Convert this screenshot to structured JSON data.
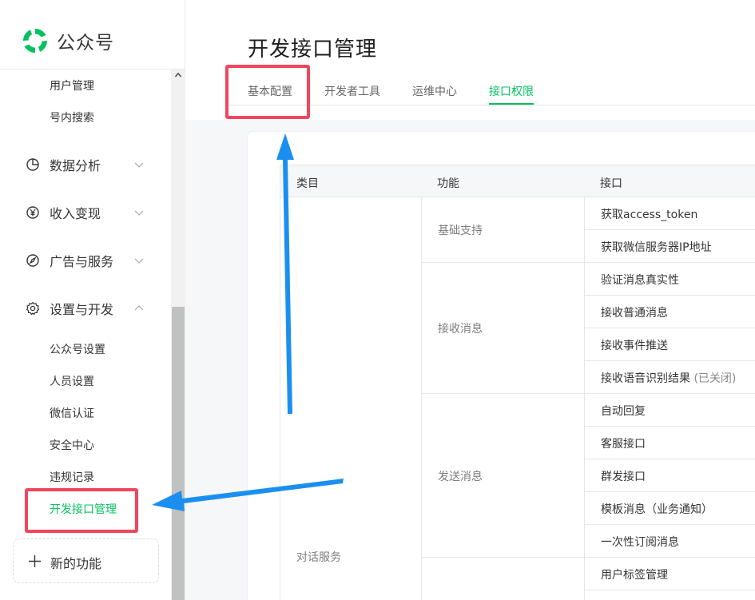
{
  "sidebar": {
    "brand": "公众号",
    "top_items": [
      {
        "label": "用户管理"
      },
      {
        "label": "号内搜索"
      }
    ],
    "categories": [
      {
        "label": "数据分析",
        "icon": "pie-chart-icon",
        "expanded": false
      },
      {
        "label": "收入变现",
        "icon": "yen-coin-icon",
        "expanded": false
      },
      {
        "label": "广告与服务",
        "icon": "compass-icon",
        "expanded": false
      },
      {
        "label": "设置与开发",
        "icon": "gear-icon",
        "expanded": true
      }
    ],
    "settings_items": [
      {
        "label": "公众号设置"
      },
      {
        "label": "人员设置"
      },
      {
        "label": "微信认证"
      },
      {
        "label": "安全中心"
      },
      {
        "label": "违规记录"
      },
      {
        "label": "开发接口管理",
        "active": true
      }
    ],
    "new_function": "新的功能"
  },
  "main": {
    "title": "开发接口管理",
    "tabs": [
      {
        "label": "基本配置"
      },
      {
        "label": "开发者工具"
      },
      {
        "label": "运维中心"
      },
      {
        "label": "接口权限",
        "active": true
      }
    ],
    "table": {
      "headers": [
        "类目",
        "功能",
        "接口"
      ],
      "category": "对话服务",
      "groups": [
        {
          "function": "基础支持",
          "apis": [
            {
              "name": "获取access_token"
            },
            {
              "name": "获取微信服务器IP地址"
            }
          ]
        },
        {
          "function": "接收消息",
          "apis": [
            {
              "name": "验证消息真实性"
            },
            {
              "name": "接收普通消息"
            },
            {
              "name": "接收事件推送"
            },
            {
              "name": "接收语音识别结果",
              "suffix": "(已关闭)"
            }
          ]
        },
        {
          "function": "发送消息",
          "apis": [
            {
              "name": "自动回复"
            },
            {
              "name": "客服接口"
            },
            {
              "name": "群发接口"
            },
            {
              "name": "模板消息（业务通知）"
            },
            {
              "name": "一次性订阅消息"
            }
          ]
        },
        {
          "function": "",
          "apis": [
            {
              "name": "用户标签管理"
            }
          ]
        }
      ]
    }
  },
  "colors": {
    "accent": "#07c160",
    "highlight": "#f0475e",
    "arrow": "#1b8ff0"
  }
}
